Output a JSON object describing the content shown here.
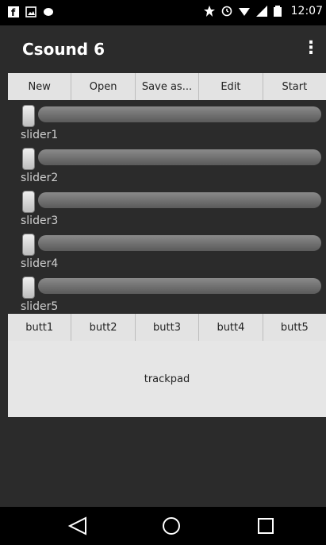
{
  "status": {
    "time": "12:07"
  },
  "appbar": {
    "title": "Csound 6"
  },
  "top_buttons": [
    "New",
    "Open",
    "Save as...",
    "Edit",
    "Start"
  ],
  "sliders": [
    {
      "label": "slider1",
      "value": 0.0
    },
    {
      "label": "slider2",
      "value": 0.0
    },
    {
      "label": "slider3",
      "value": 0.0
    },
    {
      "label": "slider4",
      "value": 0.0
    },
    {
      "label": "slider5",
      "value": 0.0
    }
  ],
  "bottom_buttons": [
    "butt1",
    "butt2",
    "butt3",
    "butt4",
    "butt5"
  ],
  "trackpad": {
    "label": "trackpad"
  },
  "nav": {
    "back_icon": "back-triangle-icon",
    "home_icon": "home-circle-icon",
    "recent_icon": "recent-square-icon"
  }
}
